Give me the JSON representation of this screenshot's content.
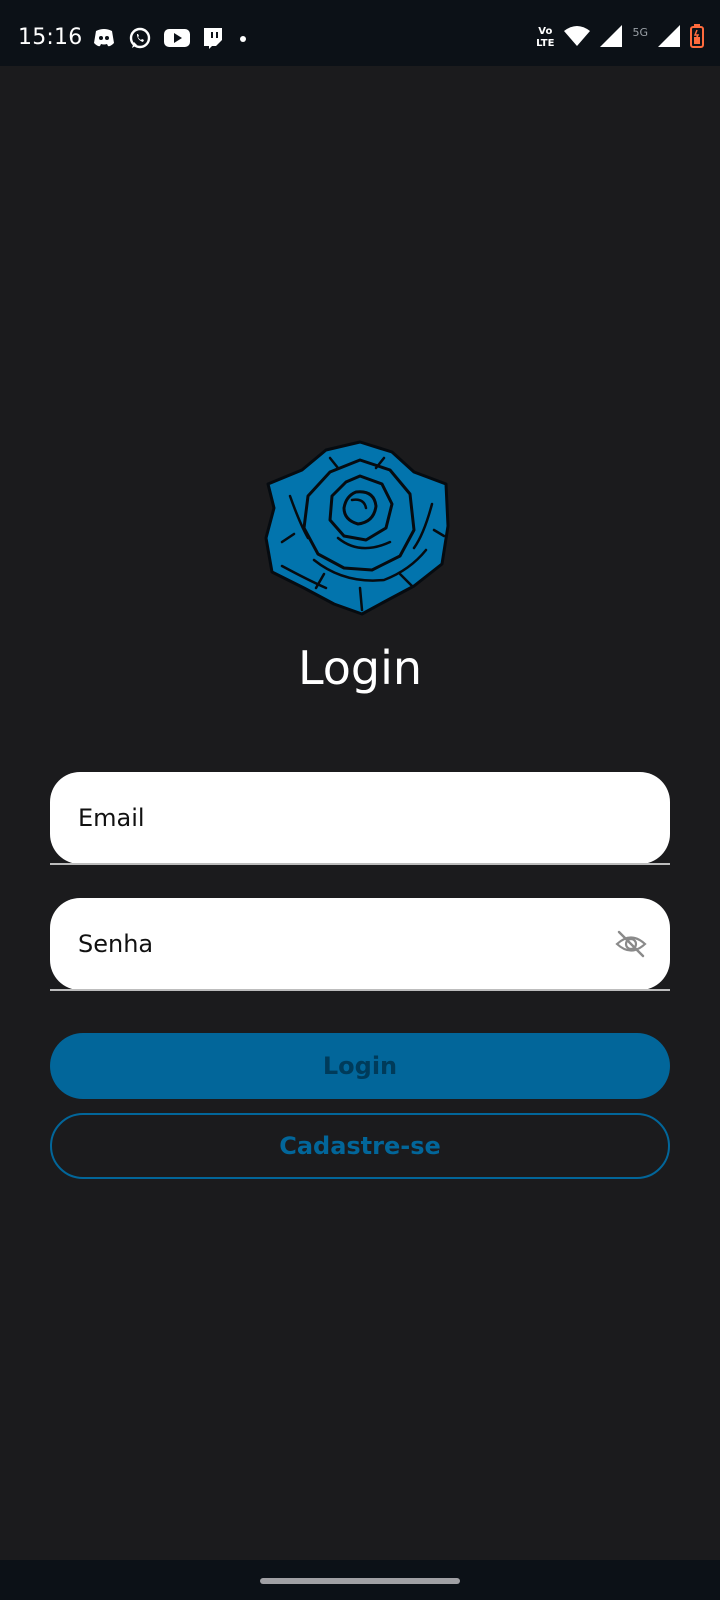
{
  "status_bar": {
    "time": "15:16",
    "notification_icons": [
      "discord-icon",
      "whatsapp-icon",
      "youtube-icon",
      "twitch-icon",
      "dot-icon"
    ],
    "volte_label_top": "Vo",
    "volte_label_bottom": "LTE",
    "network_label": "5G",
    "battery_color": "#ff6b3d"
  },
  "login": {
    "logo": "rose-icon",
    "title": "Login",
    "email_placeholder": "Email",
    "password_placeholder": "Senha",
    "password_toggle": "eye-off-icon",
    "login_button": "Login",
    "register_button": "Cadastre-se"
  },
  "colors": {
    "background": "#1b1b1d",
    "accent": "#02669a",
    "input_bg": "#ffffff"
  }
}
